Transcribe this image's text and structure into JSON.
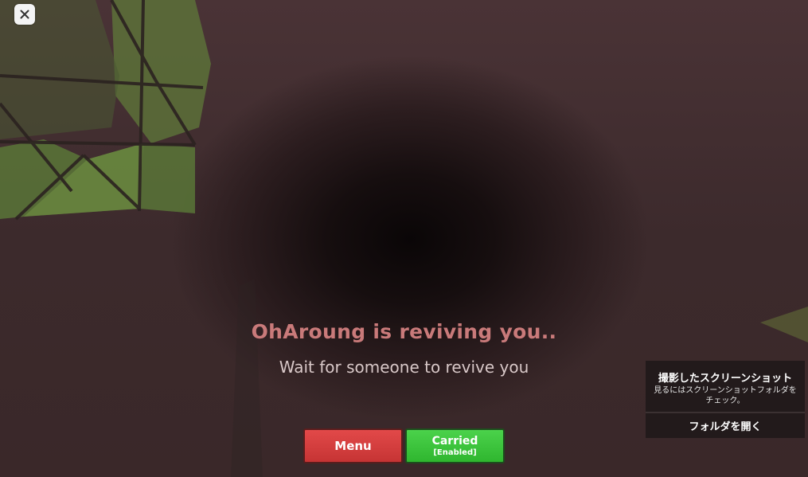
{
  "close": {
    "icon": "close-icon"
  },
  "revive": {
    "title": "OhAroung is reviving you..",
    "subtitle": "Wait for someone to revive you"
  },
  "buttons": {
    "menu_label": "Menu",
    "carried_label": "Carried",
    "carried_state": "[Enabled]"
  },
  "screenshot_panel": {
    "title": "撮影したスクリーンショット",
    "description": "見るにはスクリーンショットフォルダをチェック。",
    "open_label": "フォルダを開く"
  },
  "colors": {
    "title": "#c97a7a",
    "menu_button": "#d43f3f",
    "carried_button": "#3cc43c"
  }
}
